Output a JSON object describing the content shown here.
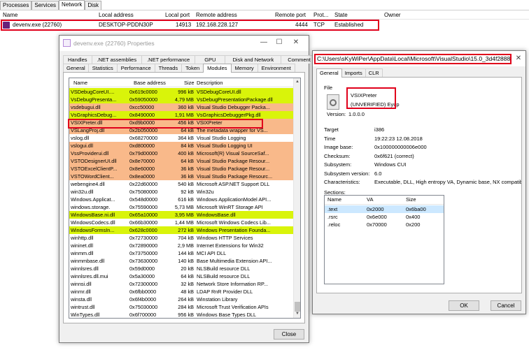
{
  "top_tabs": [
    "Processes",
    "Services",
    "Network",
    "Disk"
  ],
  "top_active_tab": "Network",
  "top_columns": [
    "Name",
    "Local address",
    "Local port",
    "Remote address",
    "Remote port",
    "Prot...",
    "State",
    "Owner"
  ],
  "top_row": {
    "name": "devenv.exe (22760)",
    "local_address": "DESKTOP-PDDN30P",
    "local_port": "14913",
    "remote_address": "192.168.228.127",
    "remote_port": "4444",
    "protocol": "TCP",
    "state": "Established"
  },
  "props_window": {
    "title": "devenv.exe (22760) Properties",
    "tabs_row1": [
      "Handles",
      ".NET assemblies",
      ".NET performance",
      "GPU",
      "Disk and Network",
      "Comment"
    ],
    "tabs_row2": [
      "General",
      "Statistics",
      "Performance",
      "Threads",
      "Token",
      "Modules",
      "Memory",
      "Environment"
    ],
    "active_tab": "Modules",
    "columns": [
      "Name",
      "Base address",
      "Size",
      "Description"
    ],
    "close_label": "Close",
    "modules": [
      {
        "name": "VSDebugCoreUI....",
        "base": "0x619c0000",
        "size": "996 kB",
        "desc": "VSDebugCoreUI.dll",
        "color": "#d9f40a"
      },
      {
        "name": "VsDebugPresenta...",
        "base": "0x59050000",
        "size": "4,79 MB",
        "desc": "VsDebugPresentationPackage.dll",
        "color": "#d9f40a"
      },
      {
        "name": "vsdebugui.dll",
        "base": "0xcc50000",
        "size": "360 kB",
        "desc": "Visual Studio Debugger Packa...",
        "color": "#f9b98a"
      },
      {
        "name": "VsGraphicsDebug...",
        "base": "0x8490000",
        "size": "1,91 MB",
        "desc": "VsGraphicsDebuggerPkg.dll",
        "color": "#d9f40a"
      },
      {
        "name": "VSIXPreter.dll",
        "base": "0xd9b0000",
        "size": "456 kB",
        "desc": "VSIXPreter",
        "color": "#f9b98a"
      },
      {
        "name": "VSLangProj.dll",
        "base": "0x2b050000",
        "size": "64 kB",
        "desc": "The metadata wrapper for VS...",
        "color": "#f9b98a"
      },
      {
        "name": "vslog.dll",
        "base": "0x68270000",
        "size": "364 kB",
        "desc": "Visual Studio Logging",
        "color": "#ffffff"
      },
      {
        "name": "vslogui.dll",
        "base": "0xd800000",
        "size": "84 kB",
        "desc": "Visual Studio Logging UI",
        "color": "#f9b98a"
      },
      {
        "name": "VssProviderui.dll",
        "base": "0x79d00000",
        "size": "400 kB",
        "desc": "Microsoft(R) Visual SourceSaf...",
        "color": "#f9b98a"
      },
      {
        "name": "VSTODesignerUI.dll",
        "base": "0x8e70000",
        "size": "64 kB",
        "desc": "Visual Studio Package Resour...",
        "color": "#f9b98a"
      },
      {
        "name": "VSTOExcelClientP...",
        "base": "0x8e60000",
        "size": "36 kB",
        "desc": "Visual Studio Package Resour...",
        "color": "#f9b98a"
      },
      {
        "name": "VSTOWordClient...",
        "base": "0x8ea0000",
        "size": "36 kB",
        "desc": "Visual Studio Package Resourc...",
        "color": "#f9b98a"
      },
      {
        "name": "webengine4.dll",
        "base": "0x22d60000",
        "size": "540 kB",
        "desc": "Microsoft ASP.NET Support DLL",
        "color": "#ffffff"
      },
      {
        "name": "win32u.dll",
        "base": "0x75080000",
        "size": "92 kB",
        "desc": "Win32u",
        "color": "#ffffff"
      },
      {
        "name": "Windows.Applicat...",
        "base": "0x548d0000",
        "size": "616 kB",
        "desc": "Windows ApplicationModel API...",
        "color": "#ffffff"
      },
      {
        "name": "windows.storage.",
        "base": "0x75590000",
        "size": "5,73 MB",
        "desc": "Microsoft WinRT Storage API",
        "color": "#ffffff"
      },
      {
        "name": "WindowsBase.ni.dll",
        "base": "0x65a10000",
        "size": "3,95 MB",
        "desc": "WindowsBase.dll",
        "color": "#d9f40a"
      },
      {
        "name": "WindowsCodecs.dll",
        "base": "0x66b30000",
        "size": "1,44 MB",
        "desc": "Microsoft Windows Codecs Lib...",
        "color": "#ffffff"
      },
      {
        "name": "WindowsFormsIn...",
        "base": "0x628c0000",
        "size": "272 kB",
        "desc": "Windows Presentation Founda...",
        "color": "#d9f40a"
      },
      {
        "name": "winhttp.dll",
        "base": "0x72730000",
        "size": "704 kB",
        "desc": "Windows HTTP Services",
        "color": "#ffffff"
      },
      {
        "name": "wininet.dll",
        "base": "0x72890000",
        "size": "2,9 MB",
        "desc": "Internet Extensions for Win32",
        "color": "#ffffff"
      },
      {
        "name": "winmm.dll",
        "base": "0x73750000",
        "size": "144 kB",
        "desc": "MCI API DLL",
        "color": "#ffffff"
      },
      {
        "name": "winmmbase.dll",
        "base": "0x73630000",
        "size": "140 kB",
        "desc": "Base Multimedia Extension API...",
        "color": "#ffffff"
      },
      {
        "name": "winnlsres.dll",
        "base": "0x59d0000",
        "size": "20 kB",
        "desc": "NLSBuild resource DLL",
        "color": "#ffffff"
      },
      {
        "name": "winnlsres.dll.mui",
        "base": "0x5a30000",
        "size": "64 kB",
        "desc": "NLSBuild resource DLL",
        "color": "#ffffff"
      },
      {
        "name": "winnsi.dll",
        "base": "0x72300000",
        "size": "32 kB",
        "desc": "Network Store Information RP...",
        "color": "#ffffff"
      },
      {
        "name": "winrnr.dll",
        "base": "0x6fbb0000",
        "size": "48 kB",
        "desc": "LDAP RnR Provider DLL",
        "color": "#ffffff"
      },
      {
        "name": "winsta.dll",
        "base": "0x6f4b0000",
        "size": "264 kB",
        "desc": "Winstation Library",
        "color": "#ffffff"
      },
      {
        "name": "wintrust.dll",
        "base": "0x75030000",
        "size": "284 kB",
        "desc": "Microsoft Trust Verification APIs",
        "color": "#ffffff"
      },
      {
        "name": "WinTypes.dll",
        "base": "0x6f700000",
        "size": "956 kB",
        "desc": "Windows Base Types DLL",
        "color": "#ffffff"
      }
    ]
  },
  "file_window": {
    "title": "C:\\Users\\sKyWiPer\\AppData\\Local\\Microsoft\\VisualStudio\\15.0_3d4f2888\\...",
    "tabs": [
      "General",
      "Imports",
      "CLR"
    ],
    "active_tab": "General",
    "file_group_label": "File",
    "file_name": "VSIXPreter",
    "file_signer": "(UNVERIFIED) Eyup",
    "version_label": "Version:",
    "version": "1.0.0.0",
    "props": [
      {
        "label": "Target",
        "value": "i386"
      },
      {
        "label": "Time",
        "value": "19:22:23 12.08.2018"
      },
      {
        "label": "Image base:",
        "value": "0x100000000006e000"
      },
      {
        "label": "Checksum:",
        "value": "0x6f621 (correct)"
      },
      {
        "label": "Subsystem:",
        "value": "Windows CUI"
      },
      {
        "label": "Subsystem version:",
        "value": "6.0"
      },
      {
        "label": "Characteristics:",
        "value": "Executable, DLL, High entropy VA, Dynamic base, NX compatible, I"
      }
    ],
    "sections_label": "Sections:",
    "section_columns": [
      "Name",
      "VA",
      "Size"
    ],
    "sections": [
      {
        "name": ".text",
        "va": "0x2000",
        "size": "0x6ba00"
      },
      {
        "name": ".rsrc",
        "va": "0x6e000",
        "size": "0x400"
      },
      {
        "name": ".reloc",
        "va": "0x70000",
        "size": "0x200"
      }
    ],
    "ok_label": "OK",
    "cancel_label": "Cancel"
  }
}
